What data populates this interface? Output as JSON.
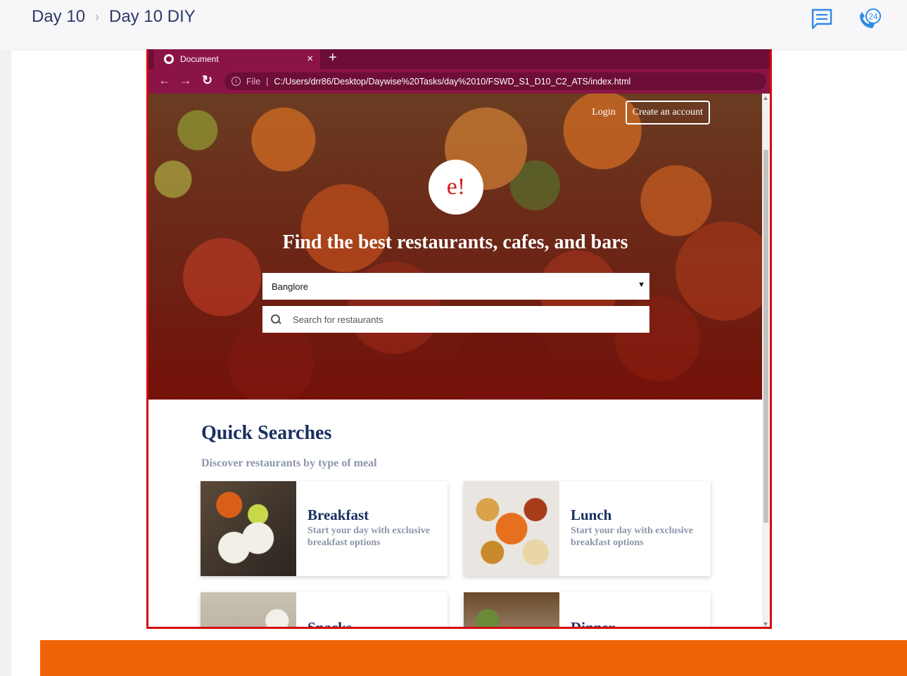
{
  "breadcrumb": {
    "items": [
      "Day 10",
      "Day 10 DIY"
    ],
    "separator": "›"
  },
  "header_icons": {
    "chat": "chat-icon",
    "support": "support-call-icon",
    "support_badge": "24"
  },
  "browser": {
    "tab_title": "Document",
    "tab_close": "×",
    "new_tab": "+",
    "url_info": "i",
    "url_scheme": "File",
    "url_separator": "|",
    "url": "C:/Users/drr86/Desktop/Daywise%20Tasks/day%2010/FSWD_S1_D10_C2_ATS/index.html"
  },
  "site": {
    "login": "Login",
    "create_account": "Create an account",
    "logo": "e!",
    "hero_title": "Find the best restaurants, cafes, and bars",
    "city_selected": "Banglore",
    "search_placeholder": "Search for restaurants",
    "quick_searches_title": "Quick Searches",
    "quick_searches_subtitle": "Discover restaurants by type of meal",
    "meals": [
      {
        "name": "Breakfast",
        "desc": "Start your day with exclusive breakfast options"
      },
      {
        "name": "Lunch",
        "desc": "Start your day with exclusive breakfast options"
      },
      {
        "name": "Snacks",
        "desc": ""
      },
      {
        "name": "Dinner",
        "desc": ""
      }
    ]
  },
  "colors": {
    "browser_tab_bar": "#6c0e35",
    "browser_toolbar": "#8b1446",
    "frame_border": "#d50b0b",
    "brand_red": "#d02020",
    "heading_navy": "#192f60",
    "banner_orange": "#f06408"
  }
}
